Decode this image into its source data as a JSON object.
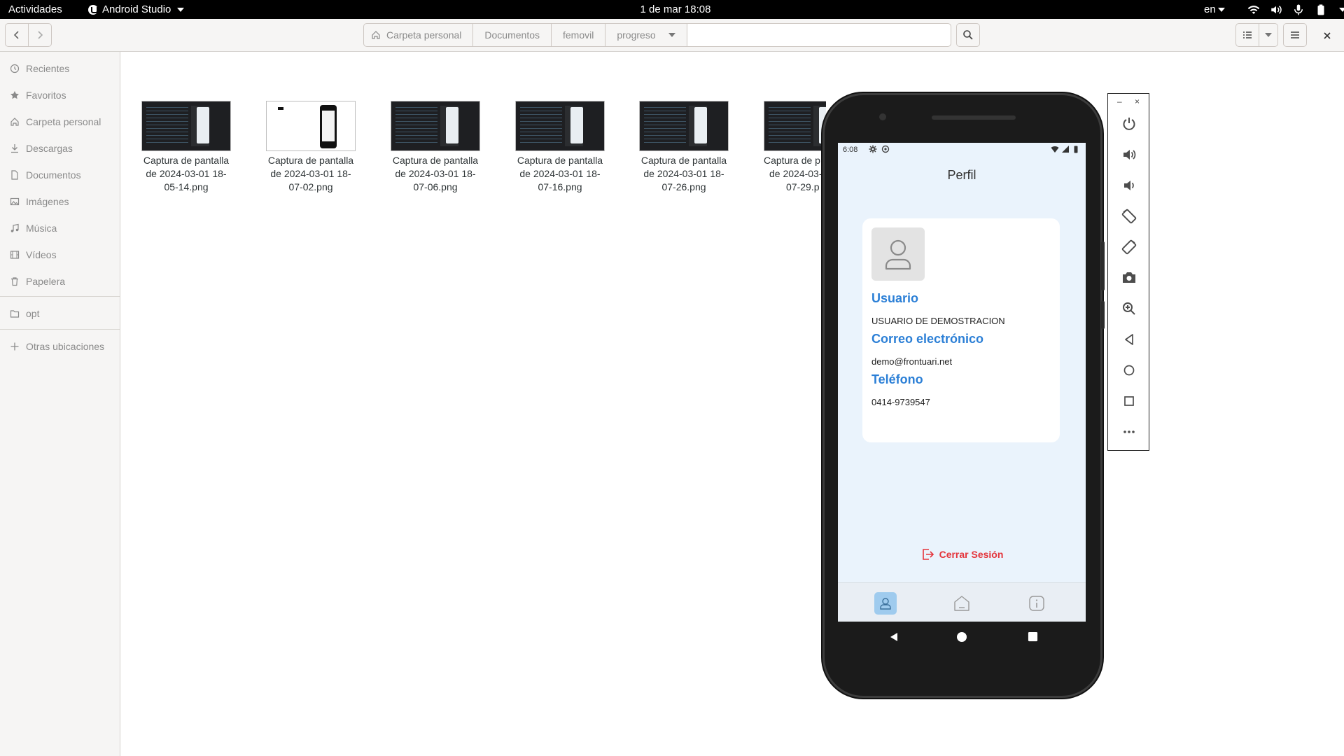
{
  "topbar": {
    "activities": "Actividades",
    "app_name": "Android Studio",
    "clock": "1 de mar  18:08",
    "lang": "en"
  },
  "pathbar": {
    "crumbs": [
      "Carpeta personal",
      "Documentos",
      "femovil",
      "progreso"
    ]
  },
  "sidebar": {
    "items": [
      {
        "label": "Recientes",
        "icon": "clock-icon"
      },
      {
        "label": "Favoritos",
        "icon": "star-icon"
      },
      {
        "label": "Carpeta personal",
        "icon": "home-icon"
      },
      {
        "label": "Descargas",
        "icon": "download-icon"
      },
      {
        "label": "Documentos",
        "icon": "document-icon"
      },
      {
        "label": "Imágenes",
        "icon": "image-icon"
      },
      {
        "label": "Música",
        "icon": "music-icon"
      },
      {
        "label": "Vídeos",
        "icon": "video-icon"
      },
      {
        "label": "Papelera",
        "icon": "trash-icon"
      }
    ],
    "opt": "opt",
    "other": "Otras ubicaciones"
  },
  "files": [
    {
      "line1": "Captura de pantalla",
      "line2": "de 2024-03-01 18-",
      "line3": "05-14.png"
    },
    {
      "line1": "Captura de pantalla",
      "line2": "de 2024-03-01 18-",
      "line3": "07-02.png"
    },
    {
      "line1": "Captura de pantalla",
      "line2": "de 2024-03-01 18-",
      "line3": "07-06.png"
    },
    {
      "line1": "Captura de pantalla",
      "line2": "de 2024-03-01 18-",
      "line3": "07-16.png"
    },
    {
      "line1": "Captura de pantalla",
      "line2": "de 2024-03-01 18-",
      "line3": "07-26.png"
    },
    {
      "line1": "Captura de p",
      "line2": "de 2024-03-",
      "line3": "07-29.p"
    }
  ],
  "phone": {
    "status_time": "6:08",
    "title": "Perfil",
    "user_label": "Usuario",
    "user_value": "USUARIO DE DEMOSTRACION",
    "email_label": "Correo electrónico",
    "email_value": "demo@frontuari.net",
    "phone_label": "Teléfono",
    "phone_value": "0414-9739547",
    "logout": "Cerrar Sesión",
    "accent": "#2b7fd6",
    "danger": "#e4343b"
  }
}
